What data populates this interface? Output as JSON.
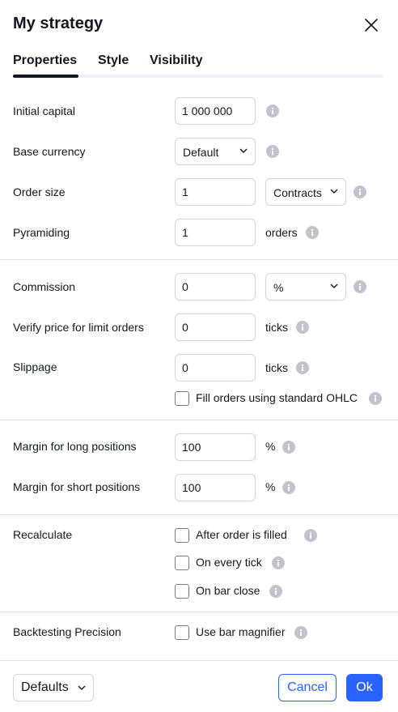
{
  "dialog": {
    "title": "My strategy"
  },
  "tabs": [
    {
      "label": "Properties",
      "active": true
    },
    {
      "label": "Style",
      "active": false
    },
    {
      "label": "Visibility",
      "active": false
    }
  ],
  "fields": {
    "initial_capital": {
      "label": "Initial capital",
      "value": "1 000 000"
    },
    "base_currency": {
      "label": "Base currency",
      "selected": "Default"
    },
    "order_size": {
      "label": "Order size",
      "value": "1",
      "unit_selected": "Contracts"
    },
    "pyramiding": {
      "label": "Pyramiding",
      "value": "1",
      "suffix": "orders"
    },
    "commission": {
      "label": "Commission",
      "value": "0",
      "unit_selected": "%"
    },
    "verify_price": {
      "label": "Verify price for limit orders",
      "value": "0",
      "suffix": "ticks"
    },
    "slippage": {
      "label": "Slippage",
      "value": "0",
      "suffix": "ticks"
    },
    "fill_orders_ohlc": {
      "label": "Fill orders using standard OHLC",
      "checked": false
    },
    "margin_long": {
      "label": "Margin for long positions",
      "value": "100",
      "suffix": "%"
    },
    "margin_short": {
      "label": "Margin for short positions",
      "value": "100",
      "suffix": "%"
    },
    "recalculate": {
      "label": "Recalculate",
      "options": [
        {
          "label": "After order is filled",
          "checked": false
        },
        {
          "label": "On every tick",
          "checked": false
        },
        {
          "label": "On bar close",
          "checked": false
        }
      ]
    },
    "backtesting_precision": {
      "label": "Backtesting Precision",
      "option": {
        "label": "Use bar magnifier",
        "checked": false
      }
    }
  },
  "footer": {
    "defaults_label": "Defaults",
    "cancel_label": "Cancel",
    "ok_label": "Ok"
  },
  "colors": {
    "accent": "#2962ff",
    "text": "#131722",
    "border": "#d1d4dc",
    "divider": "#e0e3eb",
    "info_icon": "#c1c4cd"
  },
  "icons": [
    "close-icon",
    "info-icon",
    "chevron-down-icon"
  ]
}
